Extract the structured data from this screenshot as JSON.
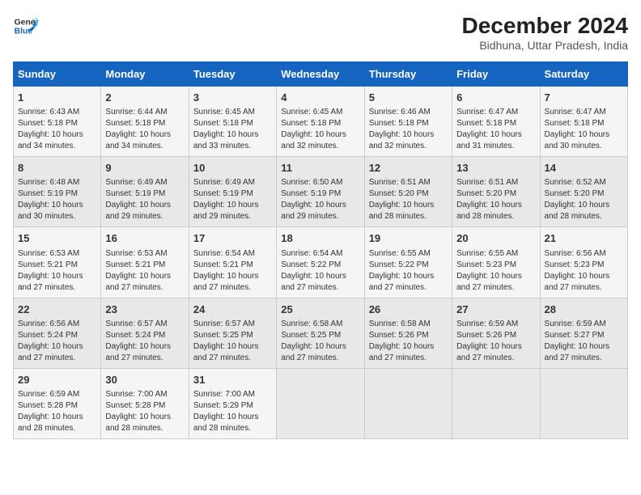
{
  "logo": {
    "line1": "General",
    "line2": "Blue"
  },
  "title": "December 2024",
  "subtitle": "Bidhuna, Uttar Pradesh, India",
  "weekdays": [
    "Sunday",
    "Monday",
    "Tuesday",
    "Wednesday",
    "Thursday",
    "Friday",
    "Saturday"
  ],
  "weeks": [
    [
      {
        "day": "1",
        "info": "Sunrise: 6:43 AM\nSunset: 5:18 PM\nDaylight: 10 hours\nand 34 minutes."
      },
      {
        "day": "2",
        "info": "Sunrise: 6:44 AM\nSunset: 5:18 PM\nDaylight: 10 hours\nand 34 minutes."
      },
      {
        "day": "3",
        "info": "Sunrise: 6:45 AM\nSunset: 5:18 PM\nDaylight: 10 hours\nand 33 minutes."
      },
      {
        "day": "4",
        "info": "Sunrise: 6:45 AM\nSunset: 5:18 PM\nDaylight: 10 hours\nand 32 minutes."
      },
      {
        "day": "5",
        "info": "Sunrise: 6:46 AM\nSunset: 5:18 PM\nDaylight: 10 hours\nand 32 minutes."
      },
      {
        "day": "6",
        "info": "Sunrise: 6:47 AM\nSunset: 5:18 PM\nDaylight: 10 hours\nand 31 minutes."
      },
      {
        "day": "7",
        "info": "Sunrise: 6:47 AM\nSunset: 5:18 PM\nDaylight: 10 hours\nand 30 minutes."
      }
    ],
    [
      {
        "day": "8",
        "info": "Sunrise: 6:48 AM\nSunset: 5:19 PM\nDaylight: 10 hours\nand 30 minutes."
      },
      {
        "day": "9",
        "info": "Sunrise: 6:49 AM\nSunset: 5:19 PM\nDaylight: 10 hours\nand 29 minutes."
      },
      {
        "day": "10",
        "info": "Sunrise: 6:49 AM\nSunset: 5:19 PM\nDaylight: 10 hours\nand 29 minutes."
      },
      {
        "day": "11",
        "info": "Sunrise: 6:50 AM\nSunset: 5:19 PM\nDaylight: 10 hours\nand 29 minutes."
      },
      {
        "day": "12",
        "info": "Sunrise: 6:51 AM\nSunset: 5:20 PM\nDaylight: 10 hours\nand 28 minutes."
      },
      {
        "day": "13",
        "info": "Sunrise: 6:51 AM\nSunset: 5:20 PM\nDaylight: 10 hours\nand 28 minutes."
      },
      {
        "day": "14",
        "info": "Sunrise: 6:52 AM\nSunset: 5:20 PM\nDaylight: 10 hours\nand 28 minutes."
      }
    ],
    [
      {
        "day": "15",
        "info": "Sunrise: 6:53 AM\nSunset: 5:21 PM\nDaylight: 10 hours\nand 27 minutes."
      },
      {
        "day": "16",
        "info": "Sunrise: 6:53 AM\nSunset: 5:21 PM\nDaylight: 10 hours\nand 27 minutes."
      },
      {
        "day": "17",
        "info": "Sunrise: 6:54 AM\nSunset: 5:21 PM\nDaylight: 10 hours\nand 27 minutes."
      },
      {
        "day": "18",
        "info": "Sunrise: 6:54 AM\nSunset: 5:22 PM\nDaylight: 10 hours\nand 27 minutes."
      },
      {
        "day": "19",
        "info": "Sunrise: 6:55 AM\nSunset: 5:22 PM\nDaylight: 10 hours\nand 27 minutes."
      },
      {
        "day": "20",
        "info": "Sunrise: 6:55 AM\nSunset: 5:23 PM\nDaylight: 10 hours\nand 27 minutes."
      },
      {
        "day": "21",
        "info": "Sunrise: 6:56 AM\nSunset: 5:23 PM\nDaylight: 10 hours\nand 27 minutes."
      }
    ],
    [
      {
        "day": "22",
        "info": "Sunrise: 6:56 AM\nSunset: 5:24 PM\nDaylight: 10 hours\nand 27 minutes."
      },
      {
        "day": "23",
        "info": "Sunrise: 6:57 AM\nSunset: 5:24 PM\nDaylight: 10 hours\nand 27 minutes."
      },
      {
        "day": "24",
        "info": "Sunrise: 6:57 AM\nSunset: 5:25 PM\nDaylight: 10 hours\nand 27 minutes."
      },
      {
        "day": "25",
        "info": "Sunrise: 6:58 AM\nSunset: 5:25 PM\nDaylight: 10 hours\nand 27 minutes."
      },
      {
        "day": "26",
        "info": "Sunrise: 6:58 AM\nSunset: 5:26 PM\nDaylight: 10 hours\nand 27 minutes."
      },
      {
        "day": "27",
        "info": "Sunrise: 6:59 AM\nSunset: 5:26 PM\nDaylight: 10 hours\nand 27 minutes."
      },
      {
        "day": "28",
        "info": "Sunrise: 6:59 AM\nSunset: 5:27 PM\nDaylight: 10 hours\nand 27 minutes."
      }
    ],
    [
      {
        "day": "29",
        "info": "Sunrise: 6:59 AM\nSunset: 5:28 PM\nDaylight: 10 hours\nand 28 minutes."
      },
      {
        "day": "30",
        "info": "Sunrise: 7:00 AM\nSunset: 5:28 PM\nDaylight: 10 hours\nand 28 minutes."
      },
      {
        "day": "31",
        "info": "Sunrise: 7:00 AM\nSunset: 5:29 PM\nDaylight: 10 hours\nand 28 minutes."
      },
      {
        "day": "",
        "info": ""
      },
      {
        "day": "",
        "info": ""
      },
      {
        "day": "",
        "info": ""
      },
      {
        "day": "",
        "info": ""
      }
    ]
  ]
}
